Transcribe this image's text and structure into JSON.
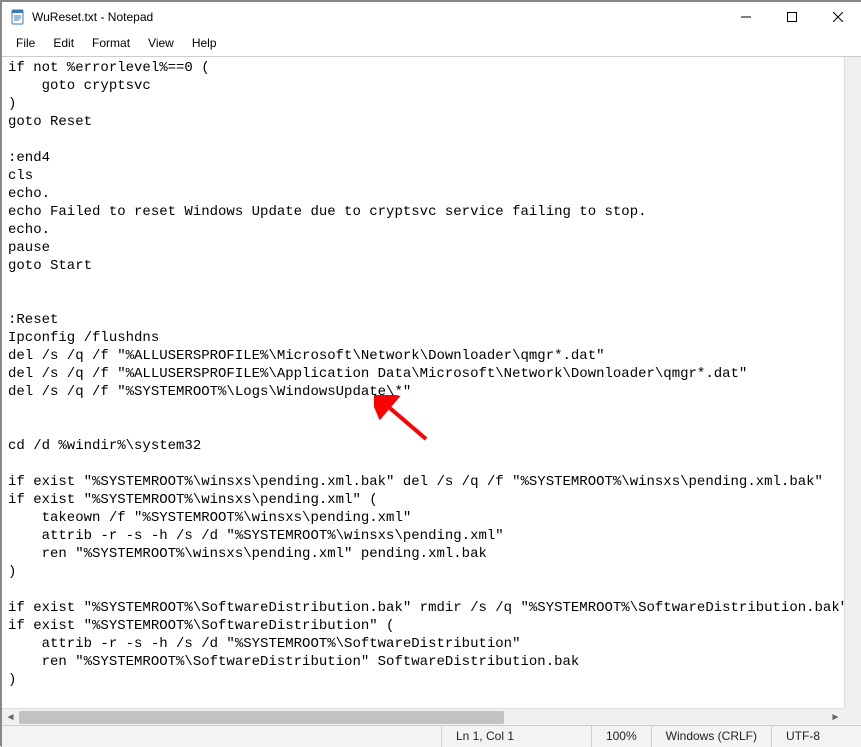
{
  "window": {
    "title": "WuReset.txt - Notepad"
  },
  "menu": {
    "file": "File",
    "edit": "Edit",
    "format": "Format",
    "view": "View",
    "help": "Help"
  },
  "editor": {
    "content": "if not %errorlevel%==0 (\n    goto cryptsvc\n)\ngoto Reset\n\n:end4\ncls\necho.\necho Failed to reset Windows Update due to cryptsvc service failing to stop.\necho.\npause\ngoto Start\n\n\n:Reset\nIpconfig /flushdns\ndel /s /q /f \"%ALLUSERSPROFILE%\\Microsoft\\Network\\Downloader\\qmgr*.dat\"\ndel /s /q /f \"%ALLUSERSPROFILE%\\Application Data\\Microsoft\\Network\\Downloader\\qmgr*.dat\"\ndel /s /q /f \"%SYSTEMROOT%\\Logs\\WindowsUpdate\\*\"\n\n\ncd /d %windir%\\system32\n\nif exist \"%SYSTEMROOT%\\winsxs\\pending.xml.bak\" del /s /q /f \"%SYSTEMROOT%\\winsxs\\pending.xml.bak\"\nif exist \"%SYSTEMROOT%\\winsxs\\pending.xml\" (\n    takeown /f \"%SYSTEMROOT%\\winsxs\\pending.xml\"\n    attrib -r -s -h /s /d \"%SYSTEMROOT%\\winsxs\\pending.xml\"\n    ren \"%SYSTEMROOT%\\winsxs\\pending.xml\" pending.xml.bak\n)\n\nif exist \"%SYSTEMROOT%\\SoftwareDistribution.bak\" rmdir /s /q \"%SYSTEMROOT%\\SoftwareDistribution.bak\"\nif exist \"%SYSTEMROOT%\\SoftwareDistribution\" (\n    attrib -r -s -h /s /d \"%SYSTEMROOT%\\SoftwareDistribution\"\n    ren \"%SYSTEMROOT%\\SoftwareDistribution\" SoftwareDistribution.bak\n)\n"
  },
  "status": {
    "position": "Ln 1, Col 1",
    "zoom": "100%",
    "line_ending": "Windows (CRLF)",
    "encoding": "UTF-8"
  },
  "annotation": {
    "arrow_color": "#ff0000"
  }
}
